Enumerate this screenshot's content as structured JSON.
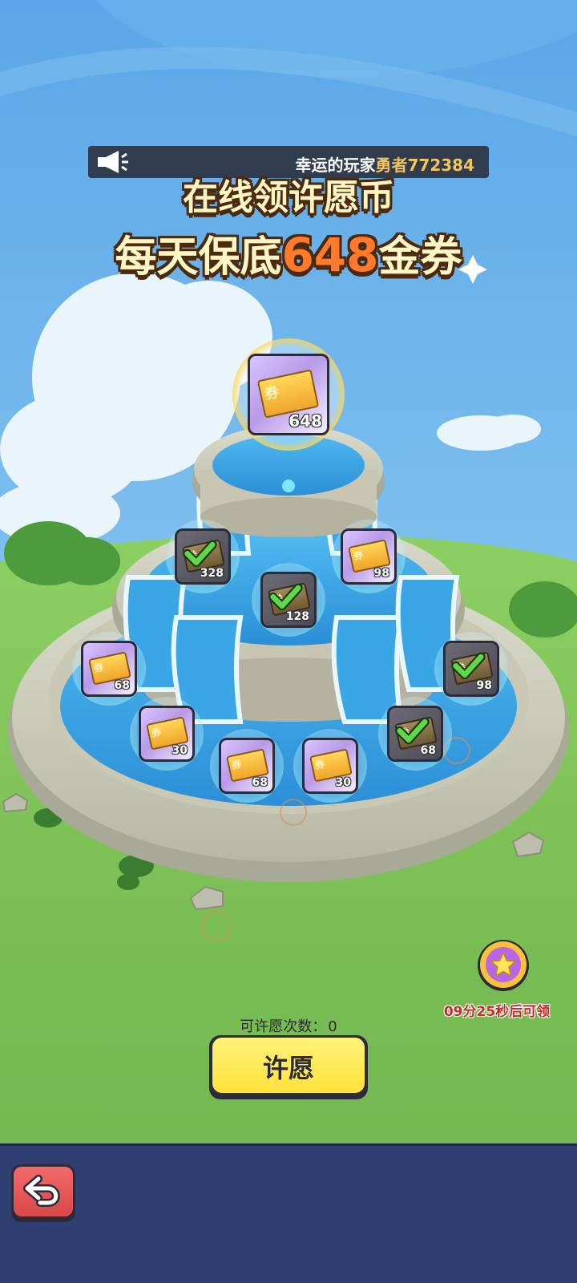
{
  "ticker": {
    "prefix": "幸运的玩家",
    "player": "勇者772384"
  },
  "headline": {
    "line1": "在线领许愿币",
    "line2_prefix": "每天保底",
    "line2_number": "648",
    "line2_suffix": "金券"
  },
  "rewards": {
    "ticket_glyph": "券",
    "items": [
      {
        "id": "top",
        "amount": "648",
        "claimed": false
      },
      {
        "id": "t2-left",
        "amount": "328",
        "claimed": true
      },
      {
        "id": "t2-mid",
        "amount": "128",
        "claimed": true
      },
      {
        "id": "t2-right",
        "amount": "98",
        "claimed": false
      },
      {
        "id": "t3-left",
        "amount": "68",
        "claimed": false
      },
      {
        "id": "t3-right",
        "amount": "98",
        "claimed": true
      },
      {
        "id": "t4-1",
        "amount": "30",
        "claimed": false
      },
      {
        "id": "t4-2",
        "amount": "68",
        "claimed": false
      },
      {
        "id": "t4-3",
        "amount": "30",
        "claimed": false
      },
      {
        "id": "t4-4",
        "amount": "68",
        "claimed": true
      }
    ]
  },
  "wish": {
    "count_label": "可许愿次数：",
    "count_value": "0",
    "button_label": "许愿"
  },
  "timer": {
    "text": "09分25秒后可领"
  },
  "colors": {
    "sky_top": "#5aa6e8",
    "grass": "#7cc35a",
    "button_yellow": "#ffe23a",
    "bottom_bar": "#2f3f72",
    "back_red": "#e05555",
    "timer_red": "#c62a2a",
    "highlight_gold": "#f2c45b",
    "number_orange": "#ff7a2a"
  },
  "icons": {
    "ticker": "megaphone-icon",
    "coin": "star-coin-icon",
    "back": "undo-arrow-icon",
    "claimed": "checkmark-icon",
    "reward": "gold-ticket-icon"
  }
}
